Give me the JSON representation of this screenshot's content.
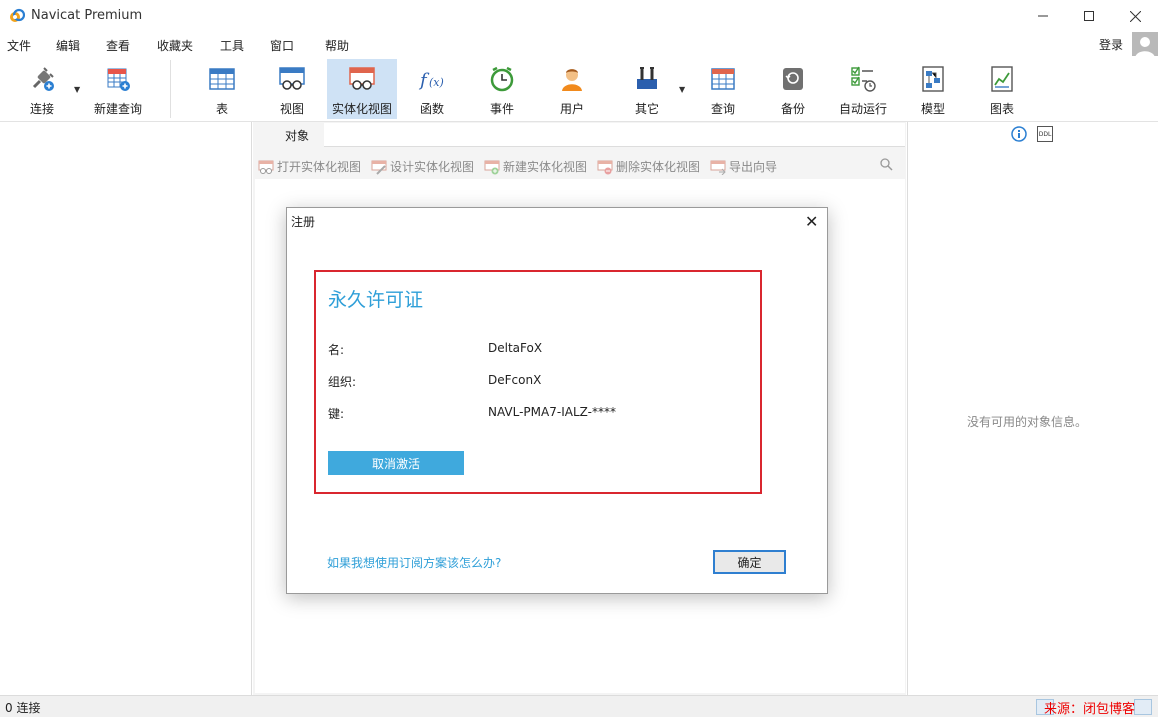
{
  "window": {
    "title": "Navicat Premium"
  },
  "menu": {
    "items": [
      "文件",
      "编辑",
      "查看",
      "收藏夹",
      "工具",
      "窗口",
      "帮助"
    ],
    "login": "登录"
  },
  "toolbar": {
    "connect": "连接",
    "new_query": "新建查询",
    "table": "表",
    "view": "视图",
    "mat_view": "实体化视图",
    "function": "函数",
    "event": "事件",
    "user": "用户",
    "other": "其它",
    "query": "查询",
    "backup": "备份",
    "automation": "自动运行",
    "model": "模型",
    "chart": "图表"
  },
  "object_tab": {
    "label": "对象"
  },
  "actions": {
    "open": "打开实体化视图",
    "design": "设计实体化视图",
    "new": "新建实体化视图",
    "delete": "删除实体化视图",
    "export": "导出向导"
  },
  "info_panel": {
    "empty_text": "没有可用的对象信息。"
  },
  "status": {
    "connections": "0 连接"
  },
  "watermark": "来源：闭包博客",
  "dialog": {
    "title": "注册",
    "heading": "永久许可证",
    "name_label": "名:",
    "name_value": "DeltaFoX",
    "org_label": "组织:",
    "org_value": "DeFconX",
    "key_label": "键:",
    "key_value": "NAVL-PMA7-IALZ-****",
    "deactivate": "取消激活",
    "subscription_link": "如果我想使用订阅方案该怎么办?",
    "ok": "确定"
  },
  "colors": {
    "accent": "#2f9fd8",
    "highlight_border": "#d9262f",
    "toolbar_active": "#cfe2f5"
  }
}
